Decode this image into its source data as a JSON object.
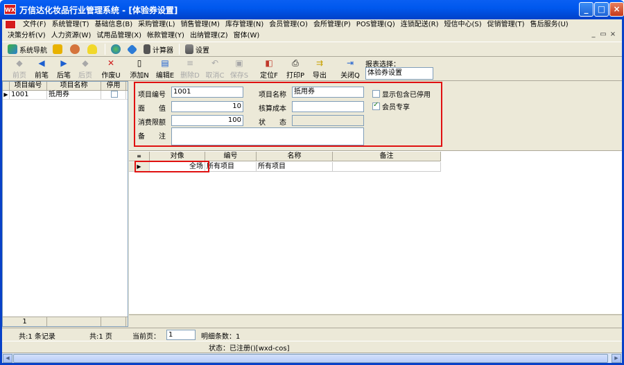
{
  "window": {
    "title": "万信达化妆品行业管理系统 - [体验券设置]",
    "logo_text": "WX",
    "minimize": "_",
    "maximize": "□",
    "close": "×"
  },
  "menu": {
    "row1": [
      "文件(F)",
      "系统管理(T)",
      "基础信息(B)",
      "采购管理(L)",
      "销售管理(M)",
      "库存管理(N)",
      "会员管理(O)",
      "会所管理(P)",
      "POS管理(Q)",
      "连锁配送(R)",
      "短信中心(S)",
      "促销管理(T)",
      "售后服务(U)"
    ],
    "row2": [
      "决策分析(V)",
      "人力资源(W)",
      "试用品管理(X)",
      "帐款管理(Y)",
      "出纳管理(Z)",
      "窗体(W)"
    ],
    "mdi": [
      "_",
      "▭",
      "×"
    ]
  },
  "toolbar1": {
    "nav": "系统导航",
    "calc": "计算器",
    "settings": "设置"
  },
  "toolbar2": {
    "first": "前页",
    "prev": "前笔",
    "next": "后笔",
    "last": "后页",
    "void": "作废U",
    "add": "添加N",
    "edit": "编辑E",
    "delete": "删除D",
    "cancel": "取消C",
    "save": "保存S",
    "locate": "定位F",
    "print": "打印P",
    "export": "导出",
    "close": "关闭Q",
    "report_label": "报表选择：",
    "report_value": "体验券设置"
  },
  "left_grid": {
    "columns": [
      "项目编号",
      "项目名称",
      "停用"
    ],
    "rows": [
      {
        "code": "1001",
        "name": "抵用券",
        "disabled": false
      }
    ],
    "footer": "1"
  },
  "form": {
    "code_label": "项目编号",
    "code_value": "1001",
    "name_label": "项目名称",
    "name_value": "抵用券",
    "face_label": "面　　值",
    "face_value": "10",
    "cost_label": "核算成本",
    "cost_value": "",
    "limit_label": "消费限额",
    "limit_value": "100",
    "state_label": "状　　态",
    "state_value": "",
    "remark_label": "备　　注",
    "remark_value": "",
    "show_disabled_label": "显示包含已停用",
    "show_disabled": false,
    "member_only_label": "会员专享",
    "member_only": true
  },
  "detail_grid": {
    "columns": [
      "",
      "对像",
      "编号",
      "名称",
      "备注"
    ],
    "rows": [
      {
        "target": "全场",
        "code": "所有项目",
        "name": "所有项目",
        "remark": ""
      }
    ]
  },
  "status": {
    "records": "共:1 条记录",
    "pages": "共:1 页",
    "current_page_label": "当前页：",
    "current_page": "1",
    "detail_count": "明细条数：1",
    "state": "状态：已注册()[wxd-cos]"
  },
  "colors": {
    "titlebar": "#0058ee",
    "frame": "#ece9d8",
    "highlight": "#e01010"
  }
}
